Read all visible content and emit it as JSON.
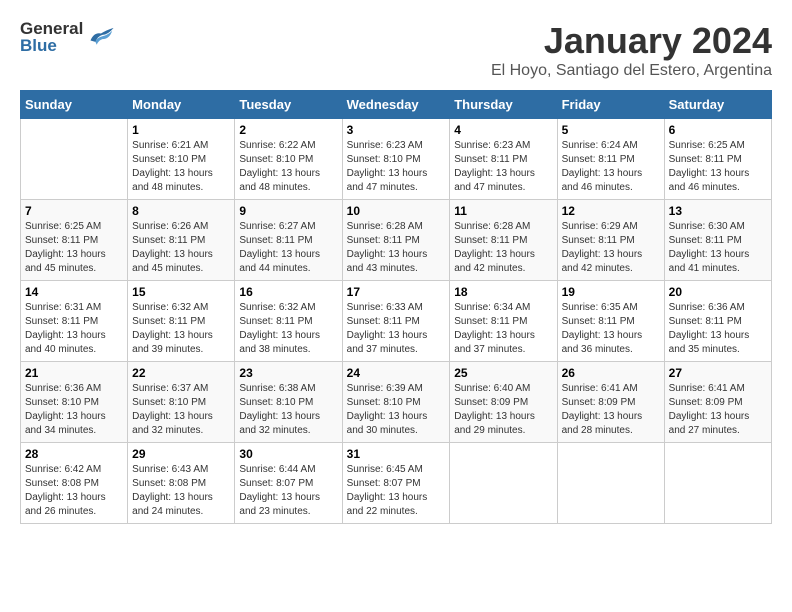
{
  "header": {
    "logo_general": "General",
    "logo_blue": "Blue",
    "title": "January 2024",
    "subtitle": "El Hoyo, Santiago del Estero, Argentina"
  },
  "days_of_week": [
    "Sunday",
    "Monday",
    "Tuesday",
    "Wednesday",
    "Thursday",
    "Friday",
    "Saturday"
  ],
  "weeks": [
    [
      {
        "day": "",
        "info": ""
      },
      {
        "day": "1",
        "info": "Sunrise: 6:21 AM\nSunset: 8:10 PM\nDaylight: 13 hours and 48 minutes."
      },
      {
        "day": "2",
        "info": "Sunrise: 6:22 AM\nSunset: 8:10 PM\nDaylight: 13 hours and 48 minutes."
      },
      {
        "day": "3",
        "info": "Sunrise: 6:23 AM\nSunset: 8:10 PM\nDaylight: 13 hours and 47 minutes."
      },
      {
        "day": "4",
        "info": "Sunrise: 6:23 AM\nSunset: 8:11 PM\nDaylight: 13 hours and 47 minutes."
      },
      {
        "day": "5",
        "info": "Sunrise: 6:24 AM\nSunset: 8:11 PM\nDaylight: 13 hours and 46 minutes."
      },
      {
        "day": "6",
        "info": "Sunrise: 6:25 AM\nSunset: 8:11 PM\nDaylight: 13 hours and 46 minutes."
      }
    ],
    [
      {
        "day": "7",
        "info": "Sunrise: 6:25 AM\nSunset: 8:11 PM\nDaylight: 13 hours and 45 minutes."
      },
      {
        "day": "8",
        "info": "Sunrise: 6:26 AM\nSunset: 8:11 PM\nDaylight: 13 hours and 45 minutes."
      },
      {
        "day": "9",
        "info": "Sunrise: 6:27 AM\nSunset: 8:11 PM\nDaylight: 13 hours and 44 minutes."
      },
      {
        "day": "10",
        "info": "Sunrise: 6:28 AM\nSunset: 8:11 PM\nDaylight: 13 hours and 43 minutes."
      },
      {
        "day": "11",
        "info": "Sunrise: 6:28 AM\nSunset: 8:11 PM\nDaylight: 13 hours and 42 minutes."
      },
      {
        "day": "12",
        "info": "Sunrise: 6:29 AM\nSunset: 8:11 PM\nDaylight: 13 hours and 42 minutes."
      },
      {
        "day": "13",
        "info": "Sunrise: 6:30 AM\nSunset: 8:11 PM\nDaylight: 13 hours and 41 minutes."
      }
    ],
    [
      {
        "day": "14",
        "info": "Sunrise: 6:31 AM\nSunset: 8:11 PM\nDaylight: 13 hours and 40 minutes."
      },
      {
        "day": "15",
        "info": "Sunrise: 6:32 AM\nSunset: 8:11 PM\nDaylight: 13 hours and 39 minutes."
      },
      {
        "day": "16",
        "info": "Sunrise: 6:32 AM\nSunset: 8:11 PM\nDaylight: 13 hours and 38 minutes."
      },
      {
        "day": "17",
        "info": "Sunrise: 6:33 AM\nSunset: 8:11 PM\nDaylight: 13 hours and 37 minutes."
      },
      {
        "day": "18",
        "info": "Sunrise: 6:34 AM\nSunset: 8:11 PM\nDaylight: 13 hours and 37 minutes."
      },
      {
        "day": "19",
        "info": "Sunrise: 6:35 AM\nSunset: 8:11 PM\nDaylight: 13 hours and 36 minutes."
      },
      {
        "day": "20",
        "info": "Sunrise: 6:36 AM\nSunset: 8:11 PM\nDaylight: 13 hours and 35 minutes."
      }
    ],
    [
      {
        "day": "21",
        "info": "Sunrise: 6:36 AM\nSunset: 8:10 PM\nDaylight: 13 hours and 34 minutes."
      },
      {
        "day": "22",
        "info": "Sunrise: 6:37 AM\nSunset: 8:10 PM\nDaylight: 13 hours and 32 minutes."
      },
      {
        "day": "23",
        "info": "Sunrise: 6:38 AM\nSunset: 8:10 PM\nDaylight: 13 hours and 32 minutes."
      },
      {
        "day": "24",
        "info": "Sunrise: 6:39 AM\nSunset: 8:10 PM\nDaylight: 13 hours and 30 minutes."
      },
      {
        "day": "25",
        "info": "Sunrise: 6:40 AM\nSunset: 8:09 PM\nDaylight: 13 hours and 29 minutes."
      },
      {
        "day": "26",
        "info": "Sunrise: 6:41 AM\nSunset: 8:09 PM\nDaylight: 13 hours and 28 minutes."
      },
      {
        "day": "27",
        "info": "Sunrise: 6:41 AM\nSunset: 8:09 PM\nDaylight: 13 hours and 27 minutes."
      }
    ],
    [
      {
        "day": "28",
        "info": "Sunrise: 6:42 AM\nSunset: 8:08 PM\nDaylight: 13 hours and 26 minutes."
      },
      {
        "day": "29",
        "info": "Sunrise: 6:43 AM\nSunset: 8:08 PM\nDaylight: 13 hours and 24 minutes."
      },
      {
        "day": "30",
        "info": "Sunrise: 6:44 AM\nSunset: 8:07 PM\nDaylight: 13 hours and 23 minutes."
      },
      {
        "day": "31",
        "info": "Sunrise: 6:45 AM\nSunset: 8:07 PM\nDaylight: 13 hours and 22 minutes."
      },
      {
        "day": "",
        "info": ""
      },
      {
        "day": "",
        "info": ""
      },
      {
        "day": "",
        "info": ""
      }
    ]
  ]
}
